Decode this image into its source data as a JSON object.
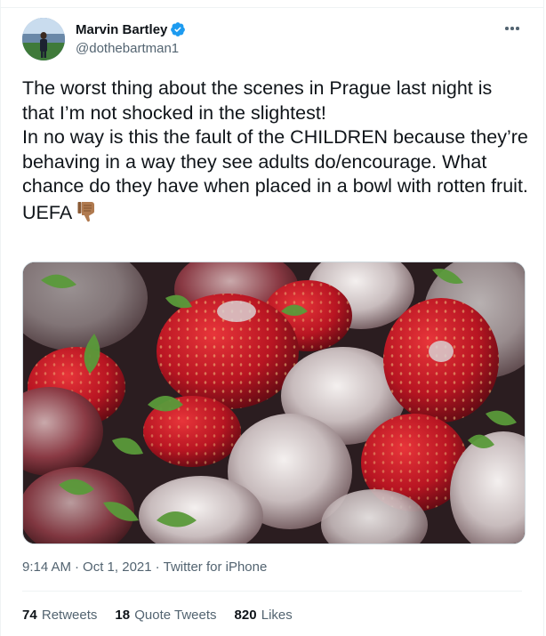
{
  "user": {
    "display_name": "Marvin Bartley",
    "handle": "@dothebartman1",
    "verified": true
  },
  "tweet": {
    "text": "The worst thing about the scenes in Prague last night is that I’m not shocked in the slightest!\nIn no way is this the fault of the CHILDREN because they’re behaving in a way they see adults do/encourage. What chance do they have when placed in a bowl with rotten fruit.\nUEFA",
    "emoji": "thumbs-down-medium-skin-tone"
  },
  "media": {
    "subject": "strawberries-moldy-photo"
  },
  "meta": {
    "time": "9:14 AM",
    "separator": "·",
    "date": "Oct 1, 2021",
    "source": "Twitter for iPhone"
  },
  "stats": [
    {
      "count": "74",
      "label": "Retweets"
    },
    {
      "count": "18",
      "label": "Quote Tweets"
    },
    {
      "count": "820",
      "label": "Likes"
    }
  ],
  "colors": {
    "accent": "#1d9bf0",
    "text": "#0f1419",
    "secondary": "#536471",
    "border": "#eff3f4"
  }
}
